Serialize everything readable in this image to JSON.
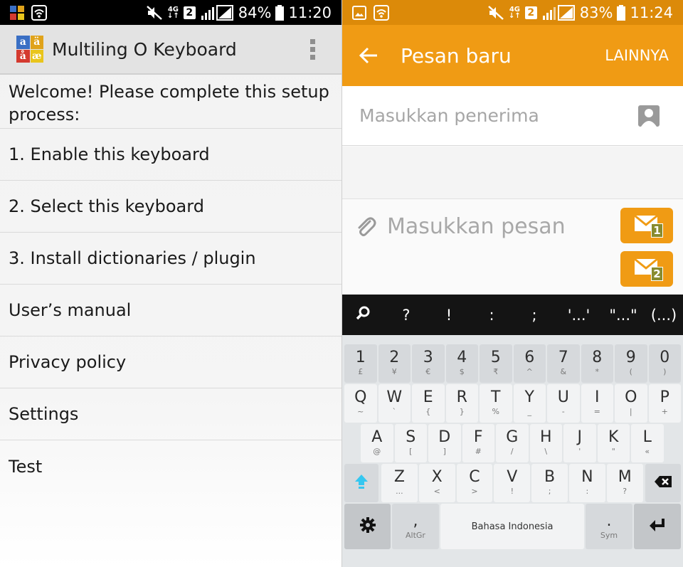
{
  "left": {
    "status": {
      "battery": "84%",
      "time": "11:20",
      "net": "4G",
      "sim": "2"
    },
    "app_title": "Multiling O Keyboard",
    "logo_letters": [
      "a",
      "ä",
      "å",
      "æ"
    ],
    "welcome": "Welcome! Please complete this setup process:",
    "items": [
      "1. Enable this keyboard",
      "2. Select this keyboard",
      "3. Install dictionaries / plugin",
      "User’s manual",
      "Privacy policy",
      "Settings",
      "Test"
    ]
  },
  "right": {
    "status": {
      "battery": "83%",
      "time": "11:24",
      "net": "4G",
      "sim": "2"
    },
    "title": "Pesan baru",
    "more": "LAINNYA",
    "recipient_placeholder": "Masukkan penerima",
    "message_placeholder": "Masukkan pesan",
    "send_sim_1": "1",
    "send_sim_2": "2",
    "keyboard": {
      "suggestions": [
        "?",
        "!",
        ":",
        ";",
        "'...'",
        "\"...\"",
        "(...)"
      ],
      "row1": [
        [
          "1",
          "£"
        ],
        [
          "2",
          "¥"
        ],
        [
          "3",
          "€"
        ],
        [
          "4",
          "$"
        ],
        [
          "5",
          "₹"
        ],
        [
          "6",
          "^"
        ],
        [
          "7",
          "&"
        ],
        [
          "8",
          "*"
        ],
        [
          "9",
          "("
        ],
        [
          "0",
          ")"
        ]
      ],
      "row2": [
        [
          "Q",
          "~"
        ],
        [
          "W",
          "`"
        ],
        [
          "E",
          "{"
        ],
        [
          "R",
          "}"
        ],
        [
          "T",
          "%"
        ],
        [
          "Y",
          "_"
        ],
        [
          "U",
          "-"
        ],
        [
          "I",
          "="
        ],
        [
          "O",
          "|"
        ],
        [
          "P",
          "+"
        ]
      ],
      "row3": [
        [
          "A",
          "@"
        ],
        [
          "S",
          "["
        ],
        [
          "D",
          "]"
        ],
        [
          "F",
          "#"
        ],
        [
          "G",
          "/"
        ],
        [
          "H",
          "\\"
        ],
        [
          "J",
          "'"
        ],
        [
          "K",
          "\""
        ],
        [
          "L",
          "«"
        ]
      ],
      "row4": [
        [
          "Z",
          "..."
        ],
        [
          "X",
          "<"
        ],
        [
          "C",
          ">"
        ],
        [
          "V",
          "!"
        ],
        [
          "B",
          ";"
        ],
        [
          "N",
          ":"
        ],
        [
          "M",
          "?"
        ]
      ],
      "comma": ",",
      "altgr": "AltGr",
      "space_label": "Bahasa Indonesia",
      "period": ".",
      "sym": "Sym"
    }
  },
  "colors": {
    "orange": "#f09b14",
    "status_orange": "#dc8a09",
    "sim_badge": "#888b2e",
    "cyan_shift": "#35c7f0"
  }
}
